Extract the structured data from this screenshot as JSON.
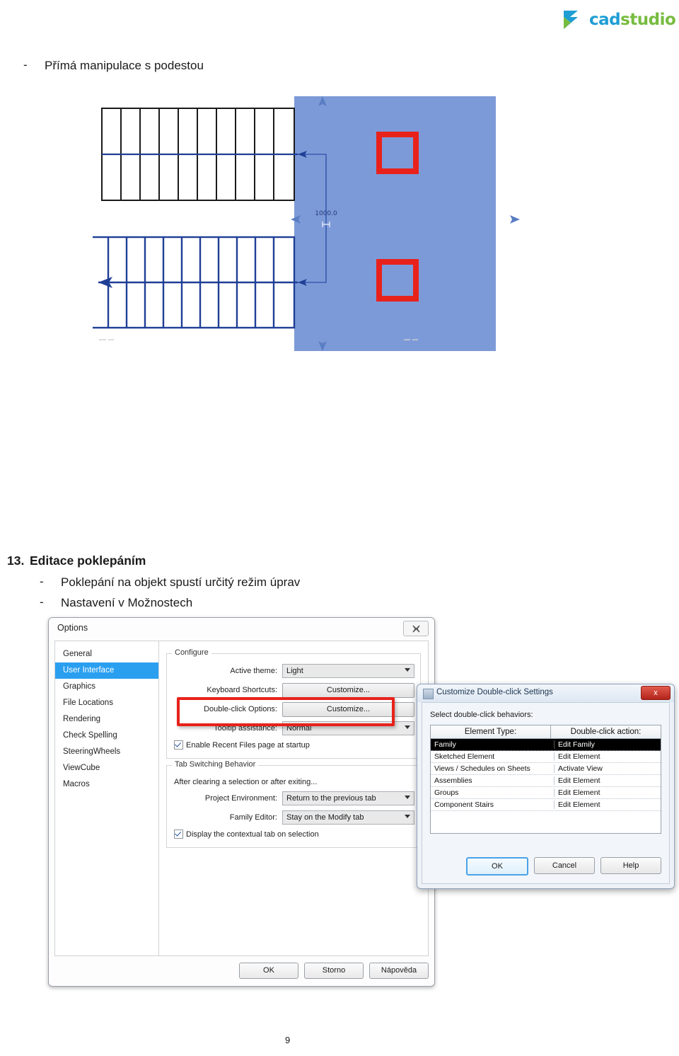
{
  "brand": {
    "logo_cad": "cad",
    "logo_studio": "studio",
    "logo_icon": "cadstudio-ribbon-logo",
    "color_blue": "#1f9ed4",
    "color_green": "#77bc3f"
  },
  "bullets": {
    "dash": "-",
    "podesta": "Přímá manipulace s podestou",
    "poklepani": "Poklepání na objekt spustí určitý režim úprav",
    "nastaveni": "Nastavení v Možnostech"
  },
  "section": {
    "number": "13.",
    "title": "Editace poklepáním"
  },
  "drawing": {
    "dimension_label": "1000.0",
    "upper_run_treads": 10,
    "lower_run_treads": 11,
    "landing_fill_color": "#7d9ad8",
    "stair_line_color": "#1f3f96",
    "upper_outline_color": "#1a1a1a",
    "highlight_color": "#e8221b"
  },
  "options_dialog": {
    "title": "Options",
    "close_icon": "close-icon",
    "sidebar": [
      {
        "label": "General",
        "active": false
      },
      {
        "label": "User Interface",
        "active": true
      },
      {
        "label": "Graphics",
        "active": false
      },
      {
        "label": "File Locations",
        "active": false
      },
      {
        "label": "Rendering",
        "active": false
      },
      {
        "label": "Check Spelling",
        "active": false
      },
      {
        "label": "SteeringWheels",
        "active": false
      },
      {
        "label": "ViewCube",
        "active": false
      },
      {
        "label": "Macros",
        "active": false
      }
    ],
    "configure": {
      "legend": "Configure",
      "active_theme_label": "Active theme:",
      "active_theme_value": "Light",
      "keyboard_shortcuts_label": "Keyboard Shortcuts:",
      "keyboard_shortcuts_button": "Customize...",
      "double_click_label": "Double-click Options:",
      "double_click_button": "Customize...",
      "tooltip_label": "Tooltip assistance:",
      "tooltip_value": "Normal",
      "recent_files_label": "Enable Recent Files page at startup",
      "recent_files_checked": true
    },
    "tab_switching": {
      "legend": "Tab Switching Behavior",
      "note": "After clearing a selection or after exiting...",
      "project_env_label": "Project Environment:",
      "project_env_value": "Return to the previous tab",
      "family_editor_label": "Family Editor:",
      "family_editor_value": "Stay on the Modify tab",
      "contextual_tab_label": "Display the contextual tab on selection",
      "contextual_tab_checked": true
    },
    "footer": {
      "ok": "OK",
      "cancel": "Storno",
      "help": "Nápověda"
    }
  },
  "double_click_dialog": {
    "title": "Customize Double-click Settings",
    "close_label": "x",
    "prompt": "Select double-click behaviors:",
    "columns": [
      "Element Type:",
      "Double-click action:"
    ],
    "rows": [
      {
        "type": "Family",
        "action": "Edit Family",
        "selected": true
      },
      {
        "type": "Sketched Element",
        "action": "Edit Element",
        "selected": false
      },
      {
        "type": "Views / Schedules on Sheets",
        "action": "Activate View",
        "selected": false
      },
      {
        "type": "Assemblies",
        "action": "Edit Element",
        "selected": false
      },
      {
        "type": "Groups",
        "action": "Edit Element",
        "selected": false
      },
      {
        "type": "Component Stairs",
        "action": "Edit Element",
        "selected": false
      }
    ],
    "buttons": {
      "ok": "OK",
      "cancel": "Cancel",
      "help": "Help"
    }
  },
  "page_number": "9"
}
